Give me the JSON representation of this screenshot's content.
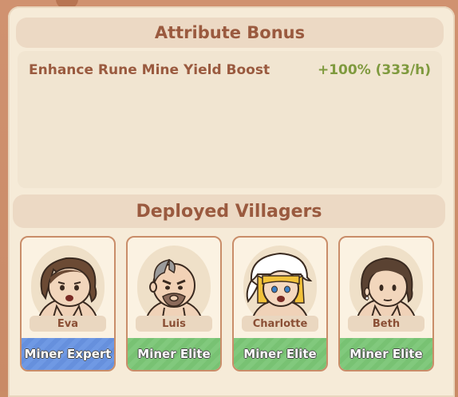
{
  "attribute_bonus": {
    "title": "Attribute Bonus",
    "rows": [
      {
        "name": "Enhance Rune Mine Yield Boost",
        "value": "+100% (333/h)"
      }
    ]
  },
  "deployed": {
    "title": "Deployed Villagers",
    "villagers": [
      {
        "name": "Eva",
        "role": "Miner Expert",
        "role_color": "#6f99e4"
      },
      {
        "name": "Luis",
        "role": "Miner Elite",
        "role_color": "#81c97d"
      },
      {
        "name": "Charlotte",
        "role": "Miner Elite",
        "role_color": "#81c97d"
      },
      {
        "name": "Beth",
        "role": "Miner Elite",
        "role_color": "#81c97d"
      }
    ]
  },
  "colors": {
    "header_text": "#9a5a3f",
    "bonus_value": "#7f9a3e",
    "panel": "#f6ebd8",
    "frame": "#c98c66"
  }
}
